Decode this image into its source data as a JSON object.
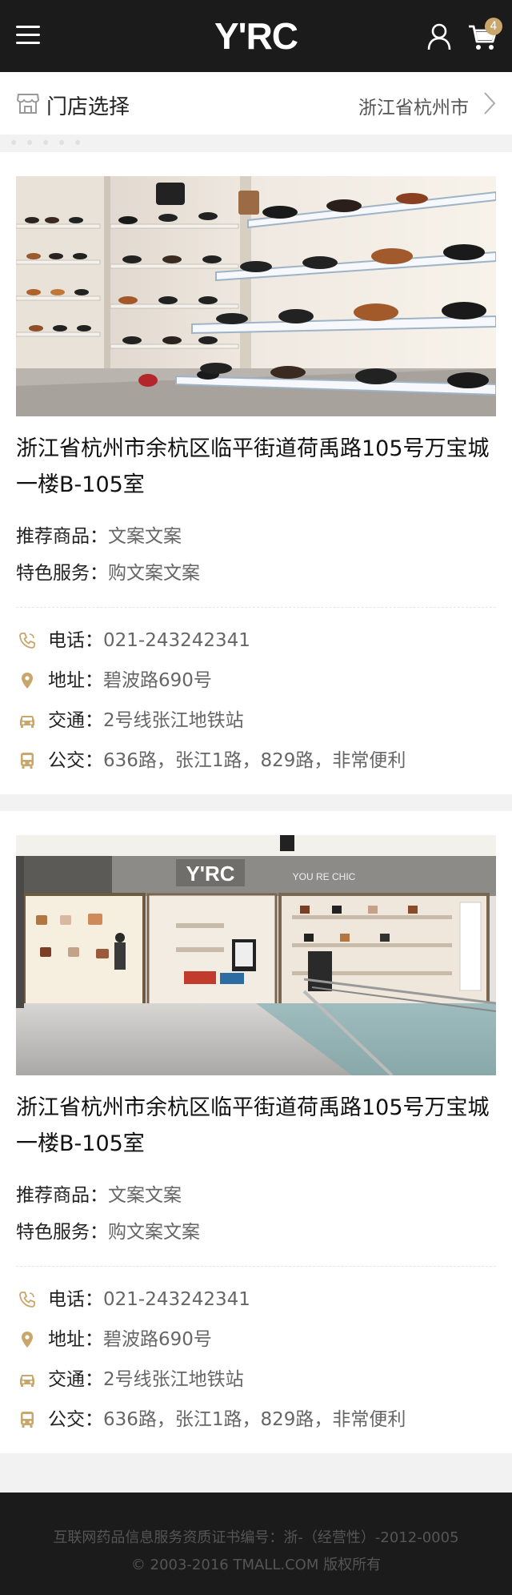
{
  "header": {
    "logo": "Y'RC",
    "cart_count": "4",
    "icons": [
      "menu-icon",
      "user-icon",
      "cart-icon"
    ]
  },
  "selector": {
    "title": "门店选择",
    "city": "浙江省杭州市",
    "icon": "store-icon"
  },
  "colors": {
    "header_bg": "#1b1b1b",
    "accent": "#c9a66b",
    "page_bg": "#f2f2f2"
  },
  "stores": [
    {
      "photo": "shoe-shelf-photo",
      "address": "浙江省杭州市余杭区临平街道荷禹路105号万宝城一楼B-105室",
      "rec_label": "推荐商品：",
      "rec_value": "文案文案",
      "svc_label": "特色服务：",
      "svc_value": "购文案文案",
      "phone_label": "电话：",
      "phone": "021-243242341",
      "addr_label": "地址：",
      "addr": "碧波路690号",
      "metro_label": "交通：",
      "metro": "2号线张江地铁站",
      "bus_label": "公交：",
      "bus": "636路，张江1路，829路，非常便利"
    },
    {
      "photo": "storefront-photo",
      "storefront_sign": "Y'RC",
      "storefront_slogan": "YOU RE CHIC",
      "address": "浙江省杭州市余杭区临平街道荷禹路105号万宝城一楼B-105室",
      "rec_label": "推荐商品：",
      "rec_value": "文案文案",
      "svc_label": "特色服务：",
      "svc_value": "购文案文案",
      "phone_label": "电话：",
      "phone": "021-243242341",
      "addr_label": "地址：",
      "addr": "碧波路690号",
      "metro_label": "交通：",
      "metro": "2号线张江地铁站",
      "bus_label": "公交：",
      "bus": "636路，张江1路，829路，非常便利"
    }
  ],
  "footer": {
    "license": "互联网药品信息服务资质证书编号：浙-（经营性）-2012-0005",
    "copyright": "© 2003-2016 TMALL.COM 版权所有"
  }
}
